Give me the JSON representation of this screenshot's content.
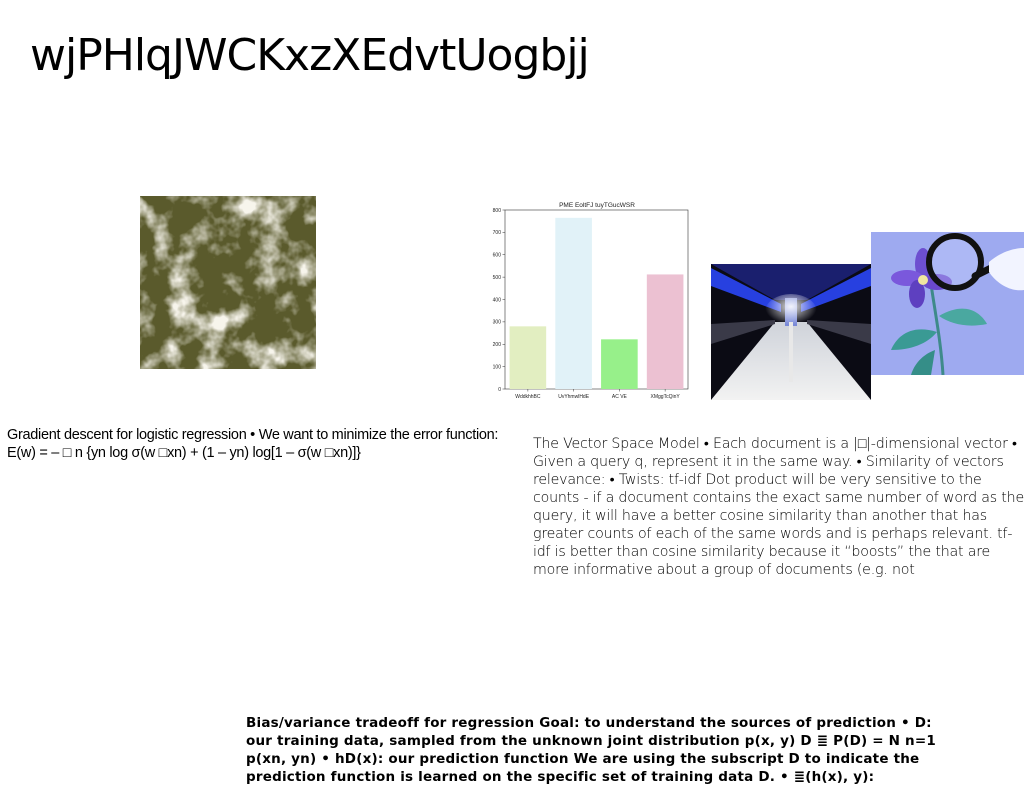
{
  "slide": {
    "title": "wjPHlqJWCKxzXEdvtUogbjj"
  },
  "images": {
    "water": "water-texture-photo",
    "subway": "subway-station-photo",
    "flower": "flower-magnifier-photo"
  },
  "chart_data": {
    "type": "bar",
    "title": "PME EoltFJ tuyTGucWSR",
    "categories": [
      "WddkhhBC",
      "UvYhmwlHdE",
      "AC VE",
      "XMggTcQinY"
    ],
    "values": [
      280,
      765,
      222,
      512
    ],
    "colors": [
      "#e2eec1",
      "#e1f2f8",
      "#97f08a",
      "#ecc1d2"
    ],
    "ylim": [
      0,
      800
    ],
    "yticks": [
      0,
      100,
      200,
      300,
      400,
      500,
      600,
      700,
      800
    ],
    "xlabel": "",
    "ylabel": "",
    "grid": false
  },
  "text": {
    "gradient_descent": "Gradient descent for logistic regression • We want to minimize the error function: E(w) = – □ n {yn log σ(w □xn) + (1 – yn) log[1 – σ(w □xn)]}",
    "vector_space": "The Vector Space Model • Each document is a |□|-dimensional vector • Given a query q, represent it in the same way. • Similarity of vectors relevance: • Twists:  tf-idf Dot product will be very sensitive to the counts - if a document contains the exact same number of word as the query, it will have a better cosine similarity than another that has greater counts of each of the same words and is perhaps relevant. tf-idf is better than cosine similarity because it “boosts” the that are more informative about a group of documents (e.g. not",
    "bias_variance": "Bias/variance tradeoff for regression Goal: to understand the sources of prediction • D: our training data, sampled from the unknown joint distribution p(x, y) D ≣ P(D) = N n=1 p(xn, yn) • hD(x): our prediction function We are using the subscript D to indicate the prediction function is learned on the specific set of training data D. • ≣(h(x), y):"
  }
}
